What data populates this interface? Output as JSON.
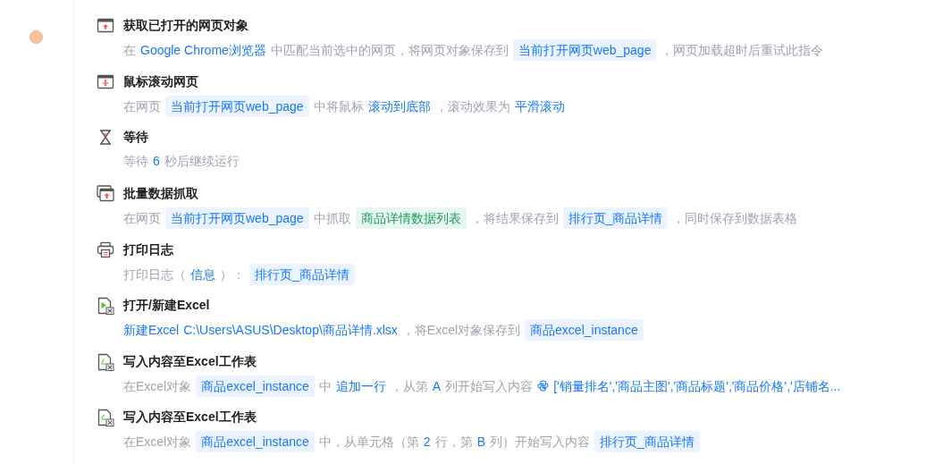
{
  "steps": [
    {
      "kind": "browser-upload",
      "breakpoint": true,
      "title": "获取已打开的网页对象",
      "parts": [
        {
          "kind": "text",
          "text": "在"
        },
        {
          "kind": "value",
          "text": "Google Chrome浏览器"
        },
        {
          "kind": "text",
          "text": "中匹配当前选中的网页，将网页对象保存到"
        },
        {
          "kind": "var",
          "text": "当前打开网页web_page"
        },
        {
          "kind": "text",
          "text": "，网页加载超时后重试此指令"
        }
      ]
    },
    {
      "kind": "browser-move",
      "breakpoint": false,
      "title": "鼠标滚动网页",
      "parts": [
        {
          "kind": "text",
          "text": "在网页"
        },
        {
          "kind": "var",
          "text": "当前打开网页web_page"
        },
        {
          "kind": "text",
          "text": "中将鼠标"
        },
        {
          "kind": "value",
          "text": "滚动到底部"
        },
        {
          "kind": "text",
          "text": "，滚动效果为"
        },
        {
          "kind": "value",
          "text": "平滑滚动"
        }
      ]
    },
    {
      "kind": "hourglass",
      "breakpoint": false,
      "title": "等待",
      "parts": [
        {
          "kind": "text",
          "text": "等待"
        },
        {
          "kind": "value",
          "text": "6"
        },
        {
          "kind": "text",
          "text": "秒后继续运行"
        }
      ]
    },
    {
      "kind": "browser-stack",
      "breakpoint": false,
      "title": "批量数据抓取",
      "parts": [
        {
          "kind": "text",
          "text": "在网页"
        },
        {
          "kind": "var",
          "text": "当前打开网页web_page"
        },
        {
          "kind": "text",
          "text": "中抓取"
        },
        {
          "kind": "list",
          "text": "商品详情数据列表"
        },
        {
          "kind": "text",
          "text": "，将结果保存到"
        },
        {
          "kind": "var",
          "text": "排行页_商品详情"
        },
        {
          "kind": "text",
          "text": "，同时保存到数据表格"
        }
      ]
    },
    {
      "kind": "printer",
      "breakpoint": false,
      "title": "打印日志",
      "parts": [
        {
          "kind": "text",
          "text": "打印日志（"
        },
        {
          "kind": "value",
          "text": "信息"
        },
        {
          "kind": "text",
          "text": "）："
        },
        {
          "kind": "var",
          "text": "排行页_商品详情"
        }
      ]
    },
    {
      "kind": "excel-play",
      "breakpoint": false,
      "title": "打开/新建Excel",
      "parts": [
        {
          "kind": "value",
          "text": "新建Excel"
        },
        {
          "kind": "value",
          "text": "C:\\Users\\ASUS\\Desktop\\商品详情.xlsx"
        },
        {
          "kind": "text",
          "text": "，将Excel对象保存到"
        },
        {
          "kind": "var",
          "text": "商品excel_instance"
        }
      ]
    },
    {
      "kind": "excel-write",
      "breakpoint": false,
      "title": "写入内容至Excel工作表",
      "parts": [
        {
          "kind": "text",
          "text": "在Excel对象"
        },
        {
          "kind": "var",
          "text": "商品excel_instance"
        },
        {
          "kind": "text",
          "text": "中"
        },
        {
          "kind": "value",
          "text": "追加一行"
        },
        {
          "kind": "text",
          "text": "，从第"
        },
        {
          "kind": "value",
          "text": "A"
        },
        {
          "kind": "text",
          "text": "列开始写入内容"
        },
        {
          "kind": "python",
          "text": "['销量排名','商品主图','商品标题','商品价格','店铺名..."
        }
      ]
    },
    {
      "kind": "excel-write",
      "breakpoint": false,
      "title": "写入内容至Excel工作表",
      "parts": [
        {
          "kind": "text",
          "text": "在Excel对象"
        },
        {
          "kind": "var",
          "text": "商品excel_instance"
        },
        {
          "kind": "text",
          "text": "中，从单元格（第"
        },
        {
          "kind": "value",
          "text": "2"
        },
        {
          "kind": "text",
          "text": "行，第"
        },
        {
          "kind": "value",
          "text": "B"
        },
        {
          "kind": "text",
          "text": "列）开始写入内容"
        },
        {
          "kind": "var",
          "text": "排行页_商品详情"
        }
      ]
    }
  ]
}
